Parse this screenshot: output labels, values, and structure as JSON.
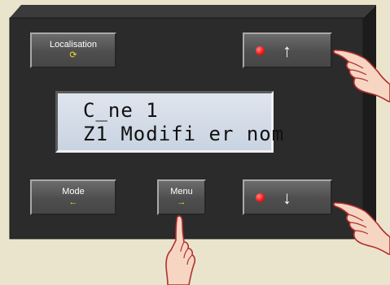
{
  "lcd": {
    "line1": "C_ne 1",
    "line2": "Z1 Modifi er nom"
  },
  "buttons": {
    "localisation": {
      "label": "Localisation",
      "icon": "refresh-icon",
      "glyph": "⟳"
    },
    "mode": {
      "label": "Mode",
      "icon": "arrow-left-icon",
      "glyph": "←"
    },
    "menu": {
      "label": "Menu",
      "icon": "arrow-right-icon",
      "glyph": "→"
    },
    "up": {
      "icon": "arrow-up-icon",
      "glyph": "↑"
    },
    "down": {
      "icon": "arrow-down-icon",
      "glyph": "↓"
    }
  },
  "colors": {
    "background": "#ebe4cd",
    "panel": "#2b2b2b",
    "lcd": "#d3dbe7",
    "button_text": "#ffffff",
    "button_sub": "#f3dc2a",
    "led": "#ff2020"
  }
}
